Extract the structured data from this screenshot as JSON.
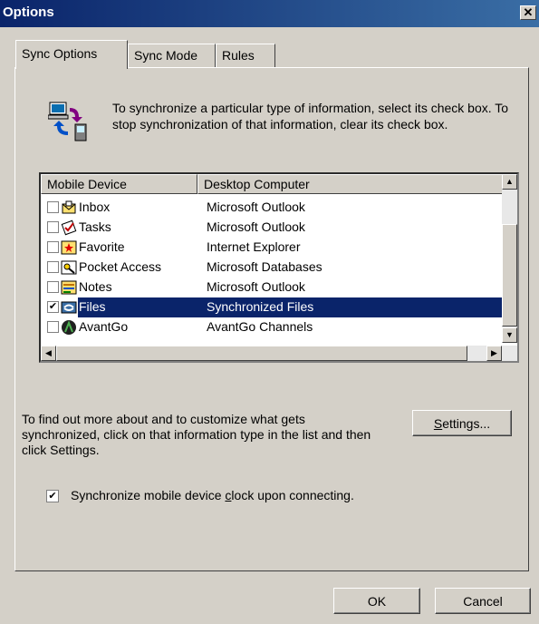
{
  "window": {
    "title": "Options",
    "close_glyph": "✕"
  },
  "tabs": [
    {
      "label": "Sync Options",
      "active": true
    },
    {
      "label": "Sync Mode",
      "active": false
    },
    {
      "label": "Rules",
      "active": false
    }
  ],
  "intro_text": "To synchronize a particular type of information, select its check box. To stop synchronization of that information, clear its check box.",
  "list": {
    "columns": [
      "Mobile Device",
      "Desktop Computer"
    ],
    "rows": [
      {
        "device": "Inbox",
        "desktop": "Microsoft Outlook",
        "checked": false,
        "icon": "inbox-icon",
        "selected": false
      },
      {
        "device": "Tasks",
        "desktop": "Microsoft Outlook",
        "checked": false,
        "icon": "tasks-icon",
        "selected": false
      },
      {
        "device": "Favorite",
        "desktop": "Internet Explorer",
        "checked": false,
        "icon": "favorite-icon",
        "selected": false
      },
      {
        "device": "Pocket Access",
        "desktop": "Microsoft Databases",
        "checked": false,
        "icon": "pocket-access-icon",
        "selected": false
      },
      {
        "device": "Notes",
        "desktop": "Microsoft Outlook",
        "checked": false,
        "icon": "notes-icon",
        "selected": false
      },
      {
        "device": "Files",
        "desktop": "Synchronized Files",
        "checked": true,
        "icon": "files-icon",
        "selected": true
      },
      {
        "device": "AvantGo",
        "desktop": "AvantGo Channels",
        "checked": false,
        "icon": "avantgo-icon",
        "selected": false
      }
    ]
  },
  "info_text": "To find out more about and to customize what gets synchronized, click on that information type in the list and then click Settings.",
  "settings_button": {
    "label": "Settings...",
    "mnemonic": "S",
    "rest": "ettings..."
  },
  "clock_option": {
    "checked": true,
    "before": "Synchronize mobile device ",
    "mnemonic": "c",
    "after": "lock upon connecting."
  },
  "buttons": {
    "ok": "OK",
    "cancel": "Cancel"
  },
  "colors": {
    "title_bar": "#0a246a",
    "selection": "#0a246a",
    "face": "#d4d0c8"
  }
}
